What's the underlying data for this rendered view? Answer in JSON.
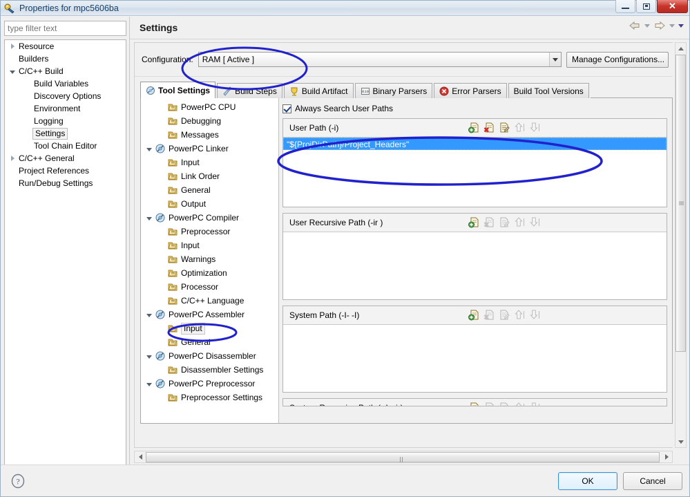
{
  "window": {
    "title": "Properties for mpc5606ba",
    "icon": "eclipse-properties-icon",
    "buttons": {
      "minimize": "minimize-button",
      "maximize": "maximize-button",
      "close": "close-button"
    }
  },
  "filter": {
    "placeholder": "type filter text",
    "value": ""
  },
  "nav_tree": [
    {
      "label": "Resource",
      "indent": 0,
      "twisty": "collapsed",
      "selected": false
    },
    {
      "label": "Builders",
      "indent": 0,
      "twisty": "none",
      "selected": false
    },
    {
      "label": "C/C++ Build",
      "indent": 0,
      "twisty": "expanded",
      "selected": false
    },
    {
      "label": "Build Variables",
      "indent": 1,
      "twisty": "none",
      "selected": false
    },
    {
      "label": "Discovery Options",
      "indent": 1,
      "twisty": "none",
      "selected": false
    },
    {
      "label": "Environment",
      "indent": 1,
      "twisty": "none",
      "selected": false
    },
    {
      "label": "Logging",
      "indent": 1,
      "twisty": "none",
      "selected": false
    },
    {
      "label": "Settings",
      "indent": 1,
      "twisty": "none",
      "selected": true
    },
    {
      "label": "Tool Chain Editor",
      "indent": 1,
      "twisty": "none",
      "selected": false
    },
    {
      "label": "C/C++ General",
      "indent": 0,
      "twisty": "collapsed",
      "selected": false
    },
    {
      "label": "Project References",
      "indent": 0,
      "twisty": "none",
      "selected": false
    },
    {
      "label": "Run/Debug Settings",
      "indent": 0,
      "twisty": "none",
      "selected": false
    }
  ],
  "page": {
    "title": "Settings",
    "nav": {
      "back": "back-arrow-icon",
      "forward": "forward-arrow-icon"
    }
  },
  "configuration": {
    "label": "Configuration:",
    "value": "RAM  [ Active ]",
    "manage_button": "Manage Configurations..."
  },
  "tabs": [
    {
      "label": "Tool Settings",
      "icon": "tool-settings-icon",
      "active": true
    },
    {
      "label": "Build Steps",
      "icon": "build-steps-icon",
      "active": false
    },
    {
      "label": "Build Artifact",
      "icon": "build-artifact-icon",
      "active": false
    },
    {
      "label": "Binary Parsers",
      "icon": "binary-parsers-icon",
      "active": false
    },
    {
      "label": "Error Parsers",
      "icon": "error-parsers-icon",
      "active": false
    },
    {
      "label": "Build Tool Versions",
      "icon": "none",
      "active": false
    }
  ],
  "tool_tree": [
    {
      "label": "PowerPC CPU",
      "indent": 1,
      "twisty": "none",
      "icon": "page-icon",
      "selected": false
    },
    {
      "label": "Debugging",
      "indent": 1,
      "twisty": "none",
      "icon": "page-icon",
      "selected": false
    },
    {
      "label": "Messages",
      "indent": 1,
      "twisty": "none",
      "icon": "page-icon",
      "selected": false
    },
    {
      "label": "PowerPC Linker",
      "indent": 0,
      "twisty": "expanded",
      "icon": "tool-icon",
      "selected": false
    },
    {
      "label": "Input",
      "indent": 1,
      "twisty": "none",
      "icon": "page-icon",
      "selected": false
    },
    {
      "label": "Link Order",
      "indent": 1,
      "twisty": "none",
      "icon": "page-icon",
      "selected": false
    },
    {
      "label": "General",
      "indent": 1,
      "twisty": "none",
      "icon": "page-icon",
      "selected": false
    },
    {
      "label": "Output",
      "indent": 1,
      "twisty": "none",
      "icon": "page-icon",
      "selected": false
    },
    {
      "label": "PowerPC Compiler",
      "indent": 0,
      "twisty": "expanded",
      "icon": "tool-icon",
      "selected": false
    },
    {
      "label": "Preprocessor",
      "indent": 1,
      "twisty": "none",
      "icon": "page-icon",
      "selected": false
    },
    {
      "label": "Input",
      "indent": 1,
      "twisty": "none",
      "icon": "page-icon",
      "selected": false
    },
    {
      "label": "Warnings",
      "indent": 1,
      "twisty": "none",
      "icon": "page-icon",
      "selected": false
    },
    {
      "label": "Optimization",
      "indent": 1,
      "twisty": "none",
      "icon": "page-icon",
      "selected": false
    },
    {
      "label": "Processor",
      "indent": 1,
      "twisty": "none",
      "icon": "page-icon",
      "selected": false
    },
    {
      "label": "C/C++ Language",
      "indent": 1,
      "twisty": "none",
      "icon": "page-icon",
      "selected": false
    },
    {
      "label": "PowerPC Assembler",
      "indent": 0,
      "twisty": "expanded",
      "icon": "tool-icon",
      "selected": false
    },
    {
      "label": "Input",
      "indent": 1,
      "twisty": "none",
      "icon": "page-icon",
      "selected": true
    },
    {
      "label": "General",
      "indent": 1,
      "twisty": "none",
      "icon": "page-icon",
      "selected": false
    },
    {
      "label": "PowerPC Disassembler",
      "indent": 0,
      "twisty": "expanded",
      "icon": "tool-icon",
      "selected": false
    },
    {
      "label": "Disassembler Settings",
      "indent": 1,
      "twisty": "none",
      "icon": "page-icon",
      "selected": false
    },
    {
      "label": "PowerPC Preprocessor",
      "indent": 0,
      "twisty": "expanded",
      "icon": "tool-icon",
      "selected": false
    },
    {
      "label": "Preprocessor Settings",
      "indent": 1,
      "twisty": "none",
      "icon": "page-icon",
      "selected": false
    }
  ],
  "options": {
    "always_search_user_paths": {
      "label": "Always Search User Paths",
      "checked": true
    }
  },
  "path_groups": [
    {
      "title": "User Path (-i)",
      "entries": [
        "\"${ProjDirPath}/Project_Headers\""
      ],
      "selected_index": 0,
      "tools": [
        "add-icon",
        "delete-icon",
        "edit-icon",
        "move-up-icon",
        "move-down-icon"
      ],
      "tools_enabled": [
        true,
        true,
        true,
        false,
        false
      ]
    },
    {
      "title": "User Recursive Path (-ir )",
      "entries": [],
      "selected_index": -1,
      "tools": [
        "add-icon",
        "delete-icon",
        "edit-icon",
        "move-up-icon",
        "move-down-icon"
      ],
      "tools_enabled": [
        true,
        false,
        false,
        false,
        false
      ]
    },
    {
      "title": "System Path (-I- -I)",
      "entries": [],
      "selected_index": -1,
      "tools": [
        "add-icon",
        "delete-icon",
        "edit-icon",
        "move-up-icon",
        "move-down-icon"
      ],
      "tools_enabled": [
        true,
        false,
        false,
        false,
        false
      ]
    },
    {
      "title": "System Recursive Path ( -I-  -ir)",
      "entries": [],
      "selected_index": -1,
      "tools": [
        "add-icon",
        "delete-icon",
        "edit-icon",
        "move-up-icon",
        "move-down-icon"
      ],
      "tools_enabled": [
        true,
        false,
        false,
        false,
        false
      ]
    }
  ],
  "footer": {
    "help": "help-icon",
    "ok": "OK",
    "cancel": "Cancel"
  },
  "annotations": {
    "color": "#2222cc",
    "shapes": [
      "configuration-combo-ellipse",
      "user-path-group-ellipse",
      "assembler-input-ellipse"
    ]
  }
}
